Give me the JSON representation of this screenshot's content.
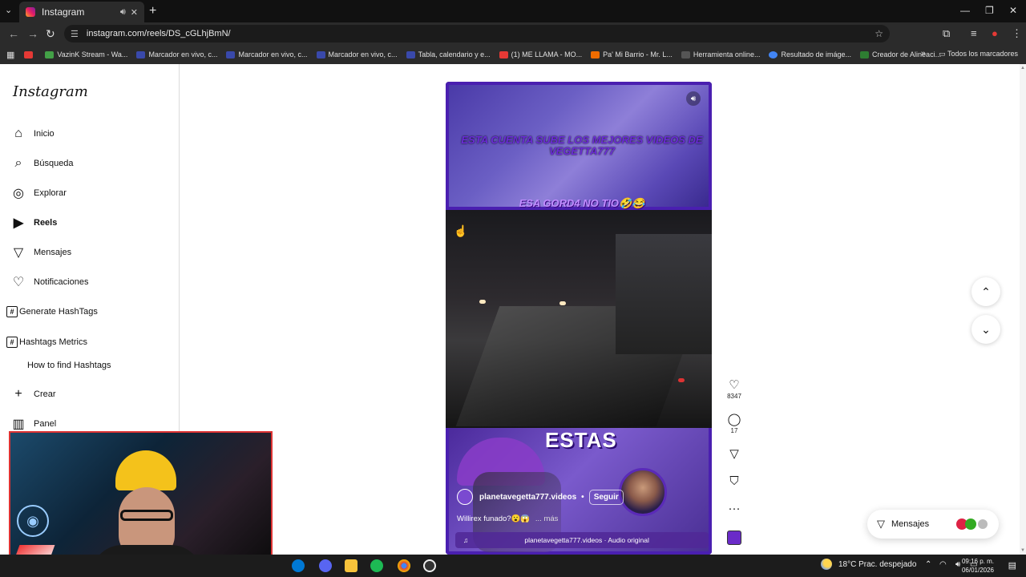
{
  "browser": {
    "tab_title": "Instagram",
    "url": "instagram.com/reels/DS_cGLhjBmN/",
    "bookmarks": [
      {
        "label": "",
        "color": "#e53935"
      },
      {
        "label": "VazinK Stream - Wa...",
        "color": "#43a047"
      },
      {
        "label": "Marcador en vivo, c...",
        "color": "#3949ab"
      },
      {
        "label": "Marcador en vivo, c...",
        "color": "#3949ab"
      },
      {
        "label": "Marcador en vivo, c...",
        "color": "#3949ab"
      },
      {
        "label": "Tabla, calendario y e...",
        "color": "#3949ab"
      },
      {
        "label": "(1) ME LLAMA - MO...",
        "color": "#e53935"
      },
      {
        "label": "Pa' Mi Barrio - Mr. L...",
        "color": "#ef6c00"
      },
      {
        "label": "Herramienta online...",
        "color": "#555555"
      },
      {
        "label": "Resultado de imáge...",
        "color": "#4285f4"
      },
      {
        "label": "Creador de Alineaci...",
        "color": "#2e7d32"
      }
    ],
    "all_bookmarks": "Todos los marcadores"
  },
  "sidebar": {
    "logo": "Instagram",
    "items": [
      {
        "label": "Inicio",
        "icon": "home-icon"
      },
      {
        "label": "Búsqueda",
        "icon": "search-icon"
      },
      {
        "label": "Explorar",
        "icon": "compass-icon"
      },
      {
        "label": "Reels",
        "icon": "reels-icon"
      },
      {
        "label": "Mensajes",
        "icon": "send-icon"
      },
      {
        "label": "Notificaciones",
        "icon": "heart-icon"
      }
    ],
    "hashtags": {
      "generate": "Generate HashTags",
      "metrics": "Hashtags Metrics",
      "how_to": "How to find Hashtags"
    },
    "create": "Crear",
    "panel": "Panel"
  },
  "reel": {
    "headline": "ESTA CUENTA SUBE LOS MEJORES VIDEOS DE VEGETTA777",
    "caption": "ESA GORD4 NO TIO🤣😂",
    "overlay_text": "ESTAS",
    "author": "planetavegetta777.videos",
    "follow": "Seguir",
    "description": "Willirex funado?😮😱",
    "more": "... más",
    "audio": "planetavegetta777.videos · Audio original",
    "likes": "8347",
    "comments": "17"
  },
  "messages_pill": {
    "label": "Mensajes"
  },
  "taskbar": {
    "weather": "18°C  Prac. despejado",
    "time": "09:16 p. m.",
    "date": "06/01/2026"
  }
}
